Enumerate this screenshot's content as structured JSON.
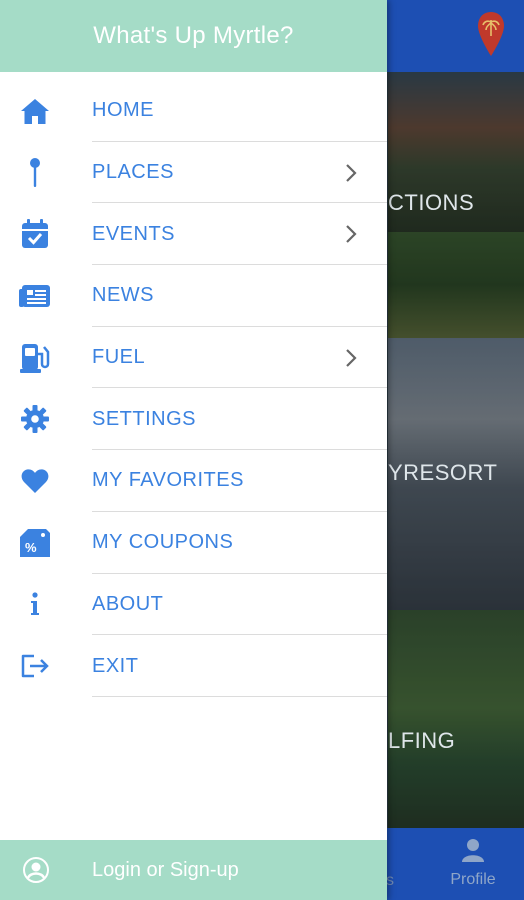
{
  "drawer": {
    "title": "What's Up Myrtle?",
    "items": [
      {
        "label": "HOME",
        "icon": "home-icon",
        "has_submenu": false
      },
      {
        "label": "PLACES",
        "icon": "map-pin-icon",
        "has_submenu": true
      },
      {
        "label": "EVENTS",
        "icon": "calendar-check-icon",
        "has_submenu": true
      },
      {
        "label": "NEWS",
        "icon": "newspaper-icon",
        "has_submenu": false
      },
      {
        "label": "FUEL",
        "icon": "gas-pump-icon",
        "has_submenu": true
      },
      {
        "label": "SETTINGS",
        "icon": "gear-icon",
        "has_submenu": false
      },
      {
        "label": "MY FAVORITES",
        "icon": "heart-icon",
        "has_submenu": false
      },
      {
        "label": "MY COUPONS",
        "icon": "coupon-tag-icon",
        "has_submenu": false
      },
      {
        "label": "ABOUT",
        "icon": "info-icon",
        "has_submenu": false
      },
      {
        "label": "EXIT",
        "icon": "exit-icon",
        "has_submenu": false
      }
    ],
    "footer": {
      "label": "Login or Sign-up",
      "icon": "user-circle-icon"
    }
  },
  "background": {
    "captions": [
      "CTIONS",
      "YRESORT",
      "LFING"
    ],
    "tabbar": {
      "partial_label": "s",
      "profile_label": "Profile"
    }
  },
  "colors": {
    "drawer_header": "#a5dcc7",
    "menu_text": "#3b82e0",
    "app_primary": "#1d4fb3"
  }
}
